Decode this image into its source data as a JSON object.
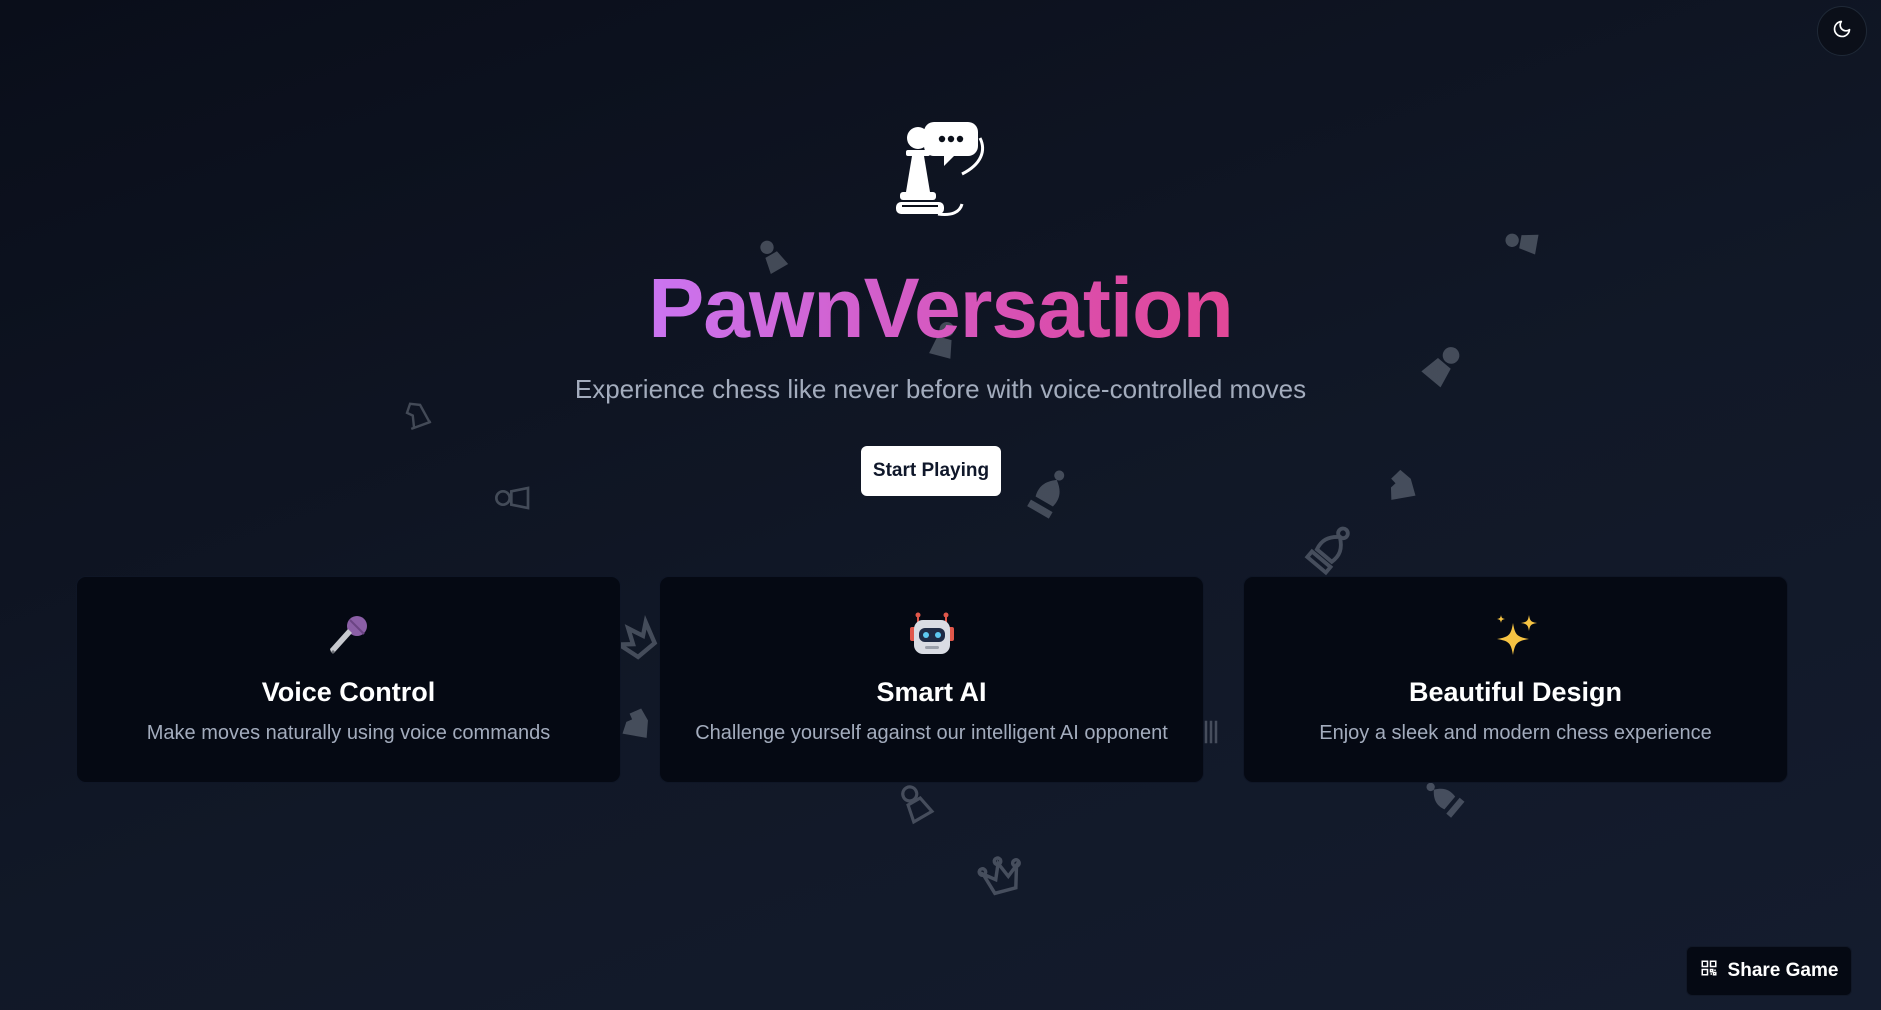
{
  "header": {
    "theme_toggle_icon": "moon-icon"
  },
  "hero": {
    "logo_icon": "pawn-speech-bubble-icon",
    "title": "PawnVersation",
    "subtitle": "Experience chess like never before with voice-controlled moves",
    "cta_label": "Start Playing"
  },
  "features": [
    {
      "icon": "microphone-icon",
      "title": "Voice Control",
      "description": "Make moves naturally using voice commands"
    },
    {
      "icon": "robot-icon",
      "title": "Smart AI",
      "description": "Challenge yourself against our intelligent AI opponent"
    },
    {
      "icon": "sparkles-icon",
      "title": "Beautiful Design",
      "description": "Enjoy a sleek and modern chess experience"
    }
  ],
  "footer": {
    "share_icon": "qr-code-icon",
    "share_label": "Share Game"
  },
  "colors": {
    "background": "#0f1524",
    "title_gradient_start": "#c77dff",
    "title_gradient_end": "#e5448c",
    "card_background": "#050913",
    "cta_background": "#ffffff"
  }
}
